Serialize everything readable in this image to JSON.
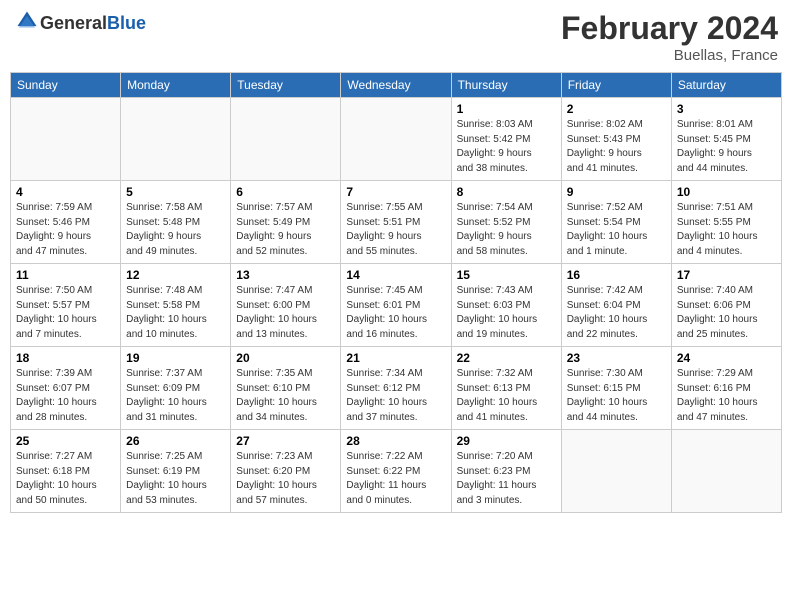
{
  "header": {
    "logo_general": "General",
    "logo_blue": "Blue",
    "month_title": "February 2024",
    "location": "Buellas, France"
  },
  "weekdays": [
    "Sunday",
    "Monday",
    "Tuesday",
    "Wednesday",
    "Thursday",
    "Friday",
    "Saturday"
  ],
  "weeks": [
    [
      {
        "day": "",
        "info": ""
      },
      {
        "day": "",
        "info": ""
      },
      {
        "day": "",
        "info": ""
      },
      {
        "day": "",
        "info": ""
      },
      {
        "day": "1",
        "info": "Sunrise: 8:03 AM\nSunset: 5:42 PM\nDaylight: 9 hours\nand 38 minutes."
      },
      {
        "day": "2",
        "info": "Sunrise: 8:02 AM\nSunset: 5:43 PM\nDaylight: 9 hours\nand 41 minutes."
      },
      {
        "day": "3",
        "info": "Sunrise: 8:01 AM\nSunset: 5:45 PM\nDaylight: 9 hours\nand 44 minutes."
      }
    ],
    [
      {
        "day": "4",
        "info": "Sunrise: 7:59 AM\nSunset: 5:46 PM\nDaylight: 9 hours\nand 47 minutes."
      },
      {
        "day": "5",
        "info": "Sunrise: 7:58 AM\nSunset: 5:48 PM\nDaylight: 9 hours\nand 49 minutes."
      },
      {
        "day": "6",
        "info": "Sunrise: 7:57 AM\nSunset: 5:49 PM\nDaylight: 9 hours\nand 52 minutes."
      },
      {
        "day": "7",
        "info": "Sunrise: 7:55 AM\nSunset: 5:51 PM\nDaylight: 9 hours\nand 55 minutes."
      },
      {
        "day": "8",
        "info": "Sunrise: 7:54 AM\nSunset: 5:52 PM\nDaylight: 9 hours\nand 58 minutes."
      },
      {
        "day": "9",
        "info": "Sunrise: 7:52 AM\nSunset: 5:54 PM\nDaylight: 10 hours\nand 1 minute."
      },
      {
        "day": "10",
        "info": "Sunrise: 7:51 AM\nSunset: 5:55 PM\nDaylight: 10 hours\nand 4 minutes."
      }
    ],
    [
      {
        "day": "11",
        "info": "Sunrise: 7:50 AM\nSunset: 5:57 PM\nDaylight: 10 hours\nand 7 minutes."
      },
      {
        "day": "12",
        "info": "Sunrise: 7:48 AM\nSunset: 5:58 PM\nDaylight: 10 hours\nand 10 minutes."
      },
      {
        "day": "13",
        "info": "Sunrise: 7:47 AM\nSunset: 6:00 PM\nDaylight: 10 hours\nand 13 minutes."
      },
      {
        "day": "14",
        "info": "Sunrise: 7:45 AM\nSunset: 6:01 PM\nDaylight: 10 hours\nand 16 minutes."
      },
      {
        "day": "15",
        "info": "Sunrise: 7:43 AM\nSunset: 6:03 PM\nDaylight: 10 hours\nand 19 minutes."
      },
      {
        "day": "16",
        "info": "Sunrise: 7:42 AM\nSunset: 6:04 PM\nDaylight: 10 hours\nand 22 minutes."
      },
      {
        "day": "17",
        "info": "Sunrise: 7:40 AM\nSunset: 6:06 PM\nDaylight: 10 hours\nand 25 minutes."
      }
    ],
    [
      {
        "day": "18",
        "info": "Sunrise: 7:39 AM\nSunset: 6:07 PM\nDaylight: 10 hours\nand 28 minutes."
      },
      {
        "day": "19",
        "info": "Sunrise: 7:37 AM\nSunset: 6:09 PM\nDaylight: 10 hours\nand 31 minutes."
      },
      {
        "day": "20",
        "info": "Sunrise: 7:35 AM\nSunset: 6:10 PM\nDaylight: 10 hours\nand 34 minutes."
      },
      {
        "day": "21",
        "info": "Sunrise: 7:34 AM\nSunset: 6:12 PM\nDaylight: 10 hours\nand 37 minutes."
      },
      {
        "day": "22",
        "info": "Sunrise: 7:32 AM\nSunset: 6:13 PM\nDaylight: 10 hours\nand 41 minutes."
      },
      {
        "day": "23",
        "info": "Sunrise: 7:30 AM\nSunset: 6:15 PM\nDaylight: 10 hours\nand 44 minutes."
      },
      {
        "day": "24",
        "info": "Sunrise: 7:29 AM\nSunset: 6:16 PM\nDaylight: 10 hours\nand 47 minutes."
      }
    ],
    [
      {
        "day": "25",
        "info": "Sunrise: 7:27 AM\nSunset: 6:18 PM\nDaylight: 10 hours\nand 50 minutes."
      },
      {
        "day": "26",
        "info": "Sunrise: 7:25 AM\nSunset: 6:19 PM\nDaylight: 10 hours\nand 53 minutes."
      },
      {
        "day": "27",
        "info": "Sunrise: 7:23 AM\nSunset: 6:20 PM\nDaylight: 10 hours\nand 57 minutes."
      },
      {
        "day": "28",
        "info": "Sunrise: 7:22 AM\nSunset: 6:22 PM\nDaylight: 11 hours\nand 0 minutes."
      },
      {
        "day": "29",
        "info": "Sunrise: 7:20 AM\nSunset: 6:23 PM\nDaylight: 11 hours\nand 3 minutes."
      },
      {
        "day": "",
        "info": ""
      },
      {
        "day": "",
        "info": ""
      }
    ]
  ]
}
